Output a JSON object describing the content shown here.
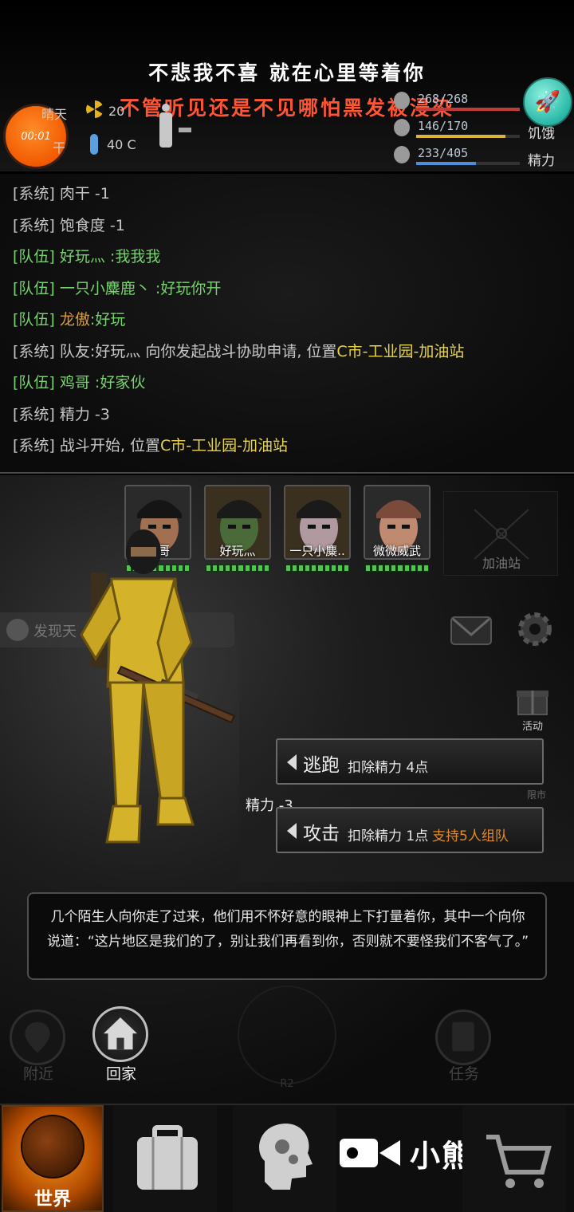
{
  "lyrics": {
    "line1": "不悲我不喜 就在心里等着你",
    "line2": "不管听见还是不见哪怕黑发被浸染"
  },
  "recorder": {
    "timer": "00:01"
  },
  "status": {
    "weather": "晴天",
    "region": "干",
    "radiation": "20",
    "temperature": "40 C"
  },
  "bars": {
    "hp": {
      "value": "268/268",
      "fill": 1.0,
      "color": "#c33a3a"
    },
    "hunger": {
      "value": "146/170",
      "label": "饥饿",
      "fill": 0.86,
      "color": "#d9b33a"
    },
    "energy": {
      "value": "233/405",
      "label": "精力",
      "fill": 0.58,
      "color": "#4a8fd8"
    }
  },
  "log": [
    {
      "tag": "[系统]",
      "kind": "sys",
      "text": "肉干 -1"
    },
    {
      "tag": "[系统]",
      "kind": "sys",
      "text": "饱食度 -1"
    },
    {
      "tag": "[队伍]",
      "kind": "team",
      "text": "好玩灬 :我我我"
    },
    {
      "tag": "[队伍]",
      "kind": "team",
      "text": "一只小麋鹿丶 :好玩你开"
    },
    {
      "tag": "[队伍]",
      "kind": "team",
      "name": "龙傲",
      "text": ":好玩"
    },
    {
      "tag": "[系统]",
      "kind": "sys",
      "text": "队友:好玩灬 向你发起战斗协助申请, 位置",
      "loc": "C市-工业园-加油站"
    },
    {
      "tag": "[队伍]",
      "kind": "team",
      "text": "鸡哥 :好家伙"
    },
    {
      "tag": "[系统]",
      "kind": "sys",
      "text": "精力 -3"
    },
    {
      "tag": "[系统]",
      "kind": "sys",
      "text": "战斗开始, 位置",
      "loc": "C市-工业园-加油站"
    }
  ],
  "enemies": [
    {
      "name": "鸡哥",
      "hp_fraction": 1.0
    },
    {
      "name": "好玩灬",
      "hp_fraction": 1.0
    },
    {
      "name": "一只小麋..",
      "hp_fraction": 1.0
    },
    {
      "name": "微微威武",
      "hp_fraction": 1.0
    }
  ],
  "location": {
    "name": "加油站"
  },
  "discover": {
    "label": "发现天"
  },
  "gift": {
    "label": "活动"
  },
  "side_faded": "限市",
  "actions": {
    "flee": {
      "label": "逃跑",
      "cost": "扣除精力 4点"
    },
    "attack": {
      "label": "攻击",
      "cost": "扣除精力 1点",
      "team_note": "支持5人组队"
    }
  },
  "energy_float": "精力 -3",
  "narrative": "几个陌生人向你走了过来，他们用不怀好意的眼神上下打量着你，其中一个向你说道：“这片地区是我们的了，别让我们再看到你，否则就不要怪我们不客气了。”",
  "round_buttons": {
    "nearby": "附近",
    "home": "回家",
    "task": "任务"
  },
  "radar_label": "R2",
  "bottom_nav": {
    "world": "世界"
  },
  "watermark": "小熊录屏"
}
